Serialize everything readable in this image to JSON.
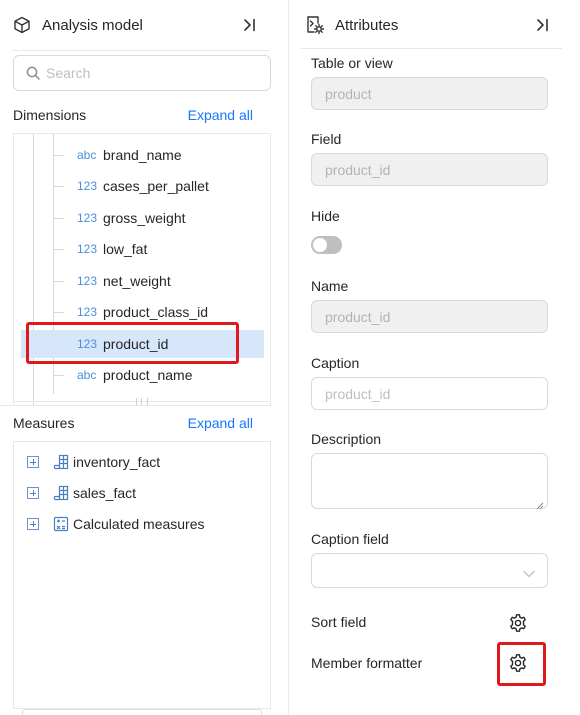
{
  "left_panel": {
    "title": "Analysis model",
    "title_icon": "cube-icon",
    "collapse_icon": "collapse-right-icon",
    "search": {
      "placeholder": "Search",
      "value": ""
    },
    "dimensions": {
      "title": "Dimensions",
      "expand_all": "Expand all",
      "items": [
        {
          "type": "abc",
          "label": "brand_name",
          "selected": false
        },
        {
          "type": "123",
          "label": "cases_per_pallet",
          "selected": false
        },
        {
          "type": "123",
          "label": "gross_weight",
          "selected": false
        },
        {
          "type": "123",
          "label": "low_fat",
          "selected": false
        },
        {
          "type": "123",
          "label": "net_weight",
          "selected": false
        },
        {
          "type": "123",
          "label": "product_class_id",
          "selected": false
        },
        {
          "type": "123",
          "label": "product_id",
          "selected": true
        },
        {
          "type": "abc",
          "label": "product_name",
          "selected": false
        }
      ]
    },
    "measures": {
      "title": "Measures",
      "expand_all": "Expand all",
      "items": [
        {
          "label": "inventory_fact",
          "icon": "measure-table-icon"
        },
        {
          "label": "sales_fact",
          "icon": "measure-table-icon"
        },
        {
          "label": "Calculated measures",
          "icon": "calculator-icon"
        }
      ]
    }
  },
  "right_panel": {
    "title": "Attributes",
    "title_icon": "attribute-settings-icon",
    "collapse_icon": "collapse-right-icon",
    "table_or_view": {
      "label": "Table or view",
      "value": "product"
    },
    "field": {
      "label": "Field",
      "value": "product_id"
    },
    "hide": {
      "label": "Hide",
      "on": false
    },
    "name": {
      "label": "Name",
      "value": "product_id"
    },
    "caption": {
      "label": "Caption",
      "placeholder": "product_id",
      "value": ""
    },
    "description": {
      "label": "Description",
      "value": ""
    },
    "caption_field": {
      "label": "Caption field",
      "value": ""
    },
    "sort_field": {
      "label": "Sort field"
    },
    "member_formatter": {
      "label": "Member formatter"
    }
  },
  "colors": {
    "accent": "#1677ff",
    "selected_row": "#d6e6fb",
    "highlight": "#e0181e",
    "type_tag": "#4a90d9"
  }
}
